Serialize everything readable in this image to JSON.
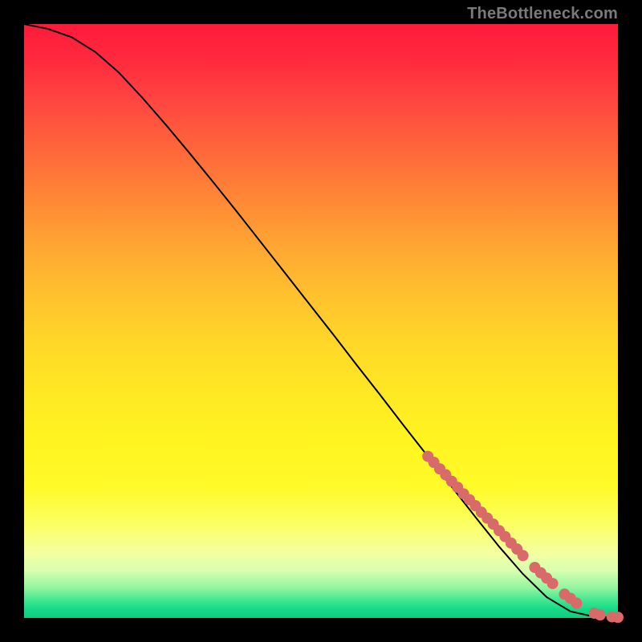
{
  "attribution": "TheBottleneck.com",
  "colors": {
    "point": "#d86a6a",
    "curve": "#000000",
    "frame": "#000000"
  },
  "chart_data": {
    "type": "line",
    "title": "",
    "xlabel": "",
    "ylabel": "",
    "xlim": [
      0,
      100
    ],
    "ylim": [
      0,
      100
    ],
    "grid": false,
    "legend": false,
    "curve_x": [
      0,
      4,
      8,
      12,
      16,
      20,
      24,
      28,
      32,
      36,
      40,
      44,
      48,
      52,
      56,
      60,
      64,
      68,
      72,
      76,
      80,
      84,
      88,
      92,
      96,
      100
    ],
    "curve_y": [
      100,
      99.2,
      97.8,
      95.3,
      91.8,
      87.5,
      82.9,
      78.1,
      73.2,
      68.2,
      63.1,
      58.0,
      52.9,
      47.8,
      42.6,
      37.5,
      32.3,
      27.2,
      22.1,
      17.0,
      12.0,
      7.4,
      3.5,
      1.1,
      0.2,
      0.1
    ],
    "points_x": [
      68,
      69,
      70,
      71,
      72,
      73,
      74,
      75,
      76,
      77,
      78,
      79,
      80,
      81,
      82,
      83,
      84,
      86,
      87,
      88,
      89,
      91,
      92,
      93,
      96,
      97,
      99,
      100
    ],
    "points_y": [
      27.2,
      26.2,
      25.1,
      24.1,
      23.0,
      22.0,
      20.9,
      19.9,
      18.9,
      17.8,
      16.8,
      15.8,
      14.7,
      13.7,
      12.6,
      11.6,
      10.5,
      8.5,
      7.6,
      6.7,
      5.8,
      4.0,
      3.3,
      2.5,
      0.8,
      0.5,
      0.2,
      0.1
    ]
  }
}
